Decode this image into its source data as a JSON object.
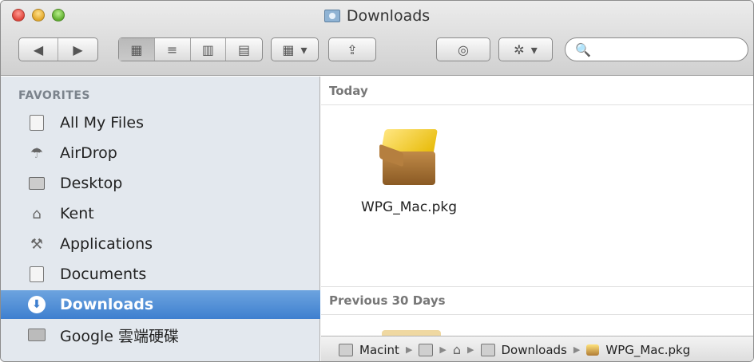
{
  "window": {
    "title": "Downloads"
  },
  "toolbar": {
    "nav_back": "◀",
    "nav_forward": "▶",
    "view_icon": "▦",
    "view_list": "≡",
    "view_columns": "▥",
    "view_coverflow": "▤",
    "arrange_icon": "▦",
    "arrange_caret": "▾",
    "share_icon": "⇪",
    "quicklook_icon": "◎",
    "action_icon": "✲",
    "action_caret": "▾",
    "search_icon": "🔍",
    "search_placeholder": ""
  },
  "sidebar": {
    "header": "FAVORITES",
    "items": [
      {
        "label": "All My Files",
        "icon": "all-files-icon"
      },
      {
        "label": "AirDrop",
        "icon": "airdrop-icon"
      },
      {
        "label": "Desktop",
        "icon": "desktop-icon"
      },
      {
        "label": "Kent",
        "icon": "home-icon"
      },
      {
        "label": "Applications",
        "icon": "applications-icon"
      },
      {
        "label": "Documents",
        "icon": "documents-icon"
      },
      {
        "label": "Downloads",
        "icon": "downloads-icon",
        "selected": true
      },
      {
        "label": "Google 雲端硬碟",
        "icon": "folder-icon"
      }
    ]
  },
  "sections": {
    "today": "Today",
    "previous": "Previous 30 Days"
  },
  "files": [
    {
      "name": "WPG_Mac.pkg",
      "icon": "package-icon"
    }
  ],
  "pathbar": {
    "items": [
      {
        "label": "Macint",
        "icon": "disk-icon"
      },
      {
        "label": "",
        "icon": "folder-icon"
      },
      {
        "label": "",
        "icon": "home-icon"
      },
      {
        "label": "Downloads",
        "icon": "downloads-folder-icon"
      },
      {
        "label": "WPG_Mac.pkg",
        "icon": "package-icon"
      }
    ],
    "separator": "▶"
  },
  "colors": {
    "selection": "#3e7fcf",
    "sidebar_bg": "#e3e8ee",
    "toolbar_bg": "#d0d0d0"
  }
}
